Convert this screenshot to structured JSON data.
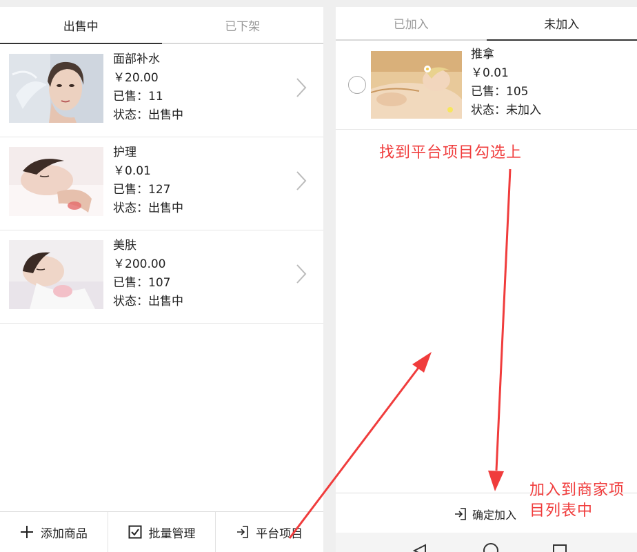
{
  "left": {
    "tabs": [
      {
        "label": "出售中",
        "active": true
      },
      {
        "label": "已下架",
        "active": false
      }
    ],
    "items": [
      {
        "name": "面部补水",
        "price": "￥20.00",
        "sold": "已售：11",
        "status": "状态：出售中"
      },
      {
        "name": "护理",
        "price": "￥0.01",
        "sold": "已售：127",
        "status": "状态：出售中"
      },
      {
        "name": "美肤",
        "price": "￥200.00",
        "sold": "已售：107",
        "status": "状态：出售中"
      }
    ],
    "bottom": {
      "add_label": "添加商品",
      "batch_label": "批量管理",
      "platform_label": "平台项目"
    }
  },
  "right": {
    "tabs": [
      {
        "label": "已加入",
        "active": false
      },
      {
        "label": "未加入",
        "active": true
      }
    ],
    "items": [
      {
        "name": "推拿",
        "price": "￥0.01",
        "sold": "已售：105",
        "status": "状态：未加入",
        "checked": false
      }
    ],
    "confirm_label": "确定加入"
  },
  "annotations": {
    "find_select": "找到平台项目勾选上",
    "add_to_list_line1": "加入到商家项",
    "add_to_list_line2": "目列表中",
    "color": "#f03c3c"
  }
}
